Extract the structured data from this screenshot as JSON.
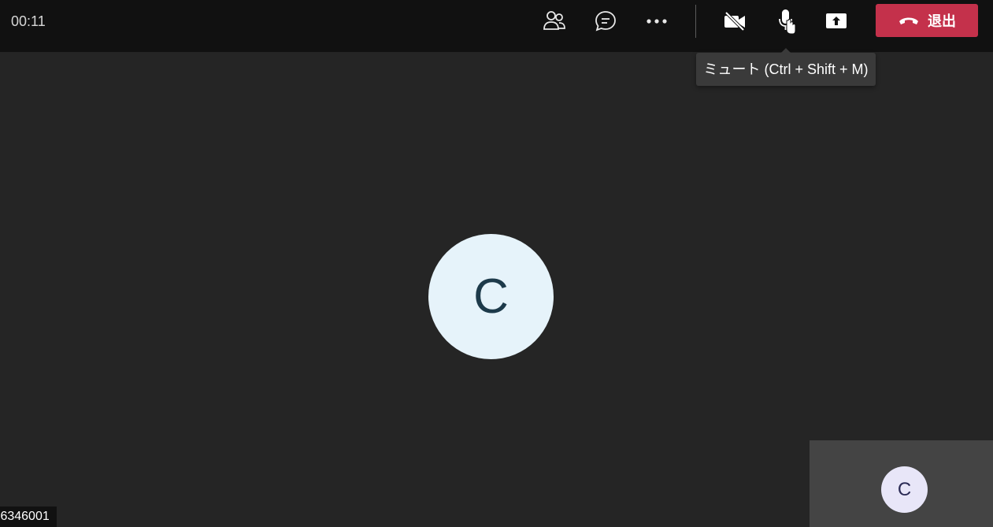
{
  "call": {
    "timer": "00:11"
  },
  "toolbar": {
    "participants_icon": "people-icon",
    "chat_icon": "chat-icon",
    "more_icon": "more-icon",
    "camera_icon": "camera-off-icon",
    "mic_icon": "microphone-icon",
    "share_icon": "share-screen-icon",
    "leave_label": "退出",
    "leave_icon": "phone-hangup-icon",
    "leave_color": "#c4314b"
  },
  "tooltip": {
    "text": "ミュート (Ctrl + Shift + M)"
  },
  "stage": {
    "participant_initial": "C",
    "participant_avatar_color": "#e6f3fa"
  },
  "self_view": {
    "initial": "C",
    "avatar_color": "#e8e6f8"
  },
  "footer": {
    "id_label": ":6346001"
  }
}
